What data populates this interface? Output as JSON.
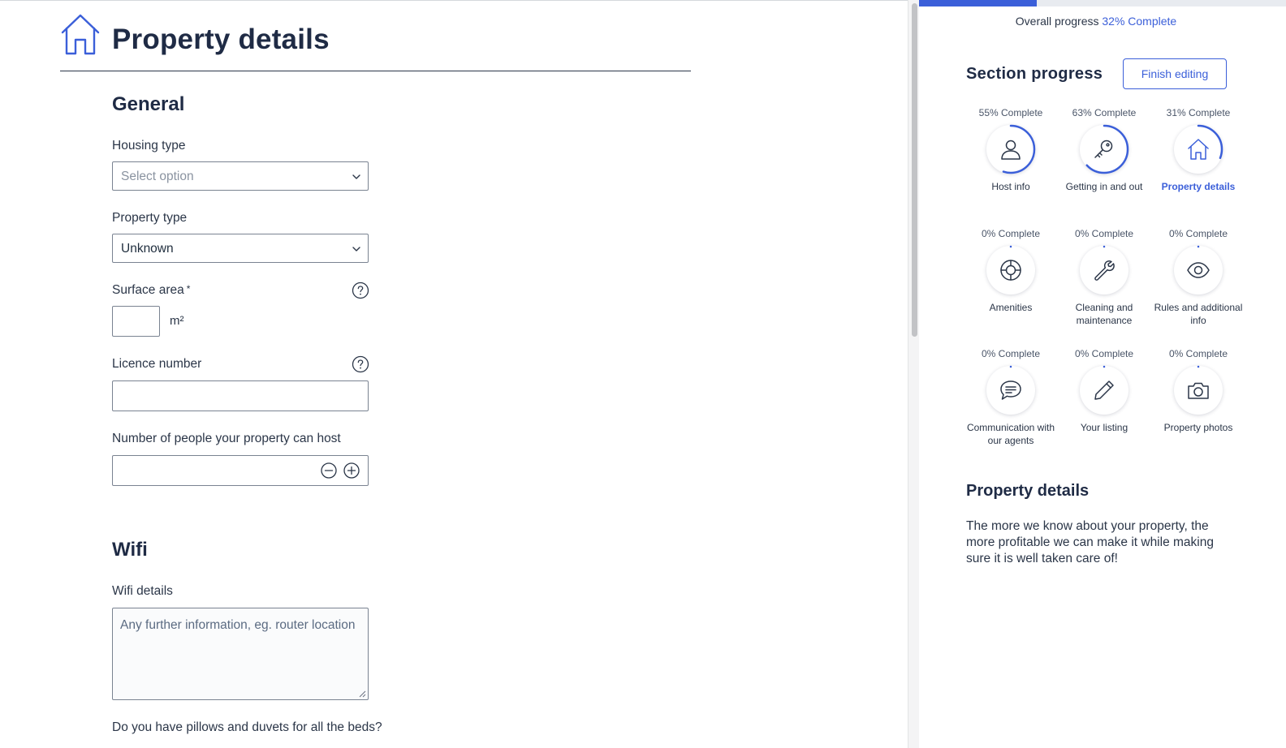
{
  "header": {
    "title": "Property details",
    "icon": "house-icon"
  },
  "general": {
    "title": "General",
    "housing_type": {
      "label": "Housing type",
      "placeholder": "Select option"
    },
    "property_type": {
      "label": "Property type",
      "value": "Unknown"
    },
    "surface_area": {
      "label": "Surface area",
      "required_mark": "*",
      "unit": "m²",
      "value": ""
    },
    "licence_number": {
      "label": "Licence number",
      "value": ""
    },
    "people_host": {
      "label": "Number of people your property can host",
      "value": ""
    }
  },
  "wifi": {
    "title": "Wifi",
    "details_label": "Wifi details",
    "details_placeholder": "Any further information, eg. router location",
    "pillows_question": "Do you have pillows and duvets for all the beds?"
  },
  "sidebar": {
    "overall_label": "Overall progress",
    "overall_percent": "32% Complete",
    "overall_fraction": 0.32,
    "section_progress_title": "Section progress",
    "finish_button": "Finish editing",
    "sections": [
      {
        "label": "Host info",
        "percent": "55% Complete",
        "fraction": 0.55,
        "icon": "person-icon",
        "active": false
      },
      {
        "label": "Getting in and out",
        "percent": "63% Complete",
        "fraction": 0.63,
        "icon": "key-icon",
        "active": false
      },
      {
        "label": "Property details",
        "percent": "31% Complete",
        "fraction": 0.31,
        "icon": "house-icon",
        "active": true
      },
      {
        "label": "Amenities",
        "percent": "0% Complete",
        "fraction": 0,
        "icon": "lifebuoy-icon",
        "active": false
      },
      {
        "label": "Cleaning and maintenance",
        "percent": "0% Complete",
        "fraction": 0,
        "icon": "wrench-icon",
        "active": false
      },
      {
        "label": "Rules and additional info",
        "percent": "0% Complete",
        "fraction": 0,
        "icon": "eye-icon",
        "active": false
      },
      {
        "label": "Communication with our agents",
        "percent": "0% Complete",
        "fraction": 0,
        "icon": "chat-bubble-icon",
        "active": false
      },
      {
        "label": "Your listing",
        "percent": "0% Complete",
        "fraction": 0,
        "icon": "pencil-icon",
        "active": false
      },
      {
        "label": "Property photos",
        "percent": "0% Complete",
        "fraction": 0,
        "icon": "camera-icon",
        "active": false
      }
    ],
    "details_title": "Property details",
    "details_text": "The more we know about your property, the more profitable we can make it while making sure it is well taken care of!"
  },
  "colors": {
    "accent": "#3b5fd9",
    "heading": "#1f2b45",
    "text": "#2b3648",
    "border": "#7a8391"
  }
}
